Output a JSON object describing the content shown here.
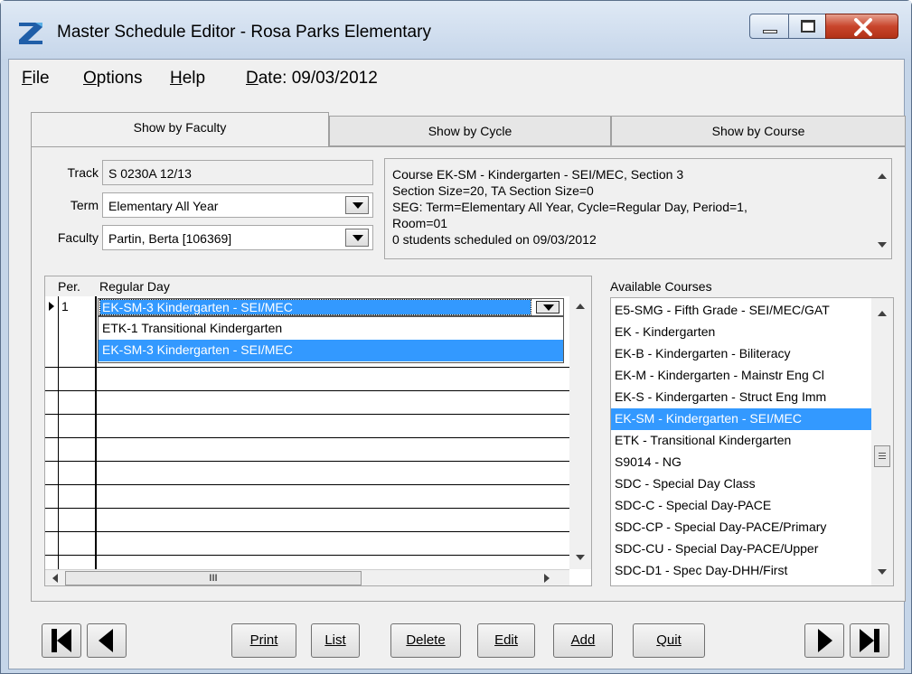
{
  "window": {
    "title": "Master Schedule Editor - Rosa Parks Elementary"
  },
  "menu": {
    "file": "File",
    "options": "Options",
    "help": "Help",
    "date": "Date: 09/03/2012"
  },
  "tabs": [
    {
      "label": "Show by Faculty",
      "active": true
    },
    {
      "label": "Show by Cycle",
      "active": false
    },
    {
      "label": "Show by Course",
      "active": false
    }
  ],
  "form": {
    "track_label": "Track",
    "track_value": "S 0230A 12/13",
    "term_label": "Term",
    "term_value": "Elementary All Year",
    "faculty_label": "Faculty",
    "faculty_value": "Partin, Berta [106369]"
  },
  "info_lines": [
    "Course EK-SM - Kindergarten - SEI/MEC, Section 3",
    "Section Size=20, TA Section Size=0",
    "SEG: Term=Elementary All Year, Cycle=Regular Day, Period=1,",
    "Room=01",
    "0 students scheduled on 09/03/2012"
  ],
  "grid": {
    "col_per": "Per.",
    "col_day": "Regular Day",
    "row1_per": "1",
    "row1_value": "EK-SM-3  Kindergarten - SEI/MEC",
    "dropdown_options": [
      "ETK-1  Transitional Kindergarten",
      "EK-SM-3  Kindergarten - SEI/MEC"
    ],
    "hscroll_thumb": "III"
  },
  "available": {
    "label": "Available Courses",
    "items": [
      "E5-SMG - Fifth Grade - SEI/MEC/GAT",
      "EK - Kindergarten",
      "EK-B - Kindergarten - Biliteracy",
      "EK-M - Kindergarten - Mainstr Eng Cl",
      "EK-S - Kindergarten - Struct Eng Imm",
      "EK-SM - Kindergarten - SEI/MEC",
      "ETK - Transitional Kindergarten",
      "S9014 - NG",
      "SDC - Special Day Class",
      "SDC-C - Special Day-PACE",
      "SDC-CP - Special Day-PACE/Primary",
      "SDC-CU - Special Day-PACE/Upper",
      "SDC-D1 - Spec Day-DHH/First"
    ],
    "selected_index": 5
  },
  "buttons": {
    "print": "Print",
    "list": "List",
    "delete": "Delete",
    "edit": "Edit",
    "add": "Add",
    "quit": "Quit"
  },
  "colors": {
    "selection": "#3399ff",
    "titlebar": "#c6d6ea",
    "close": "#c9452c"
  }
}
